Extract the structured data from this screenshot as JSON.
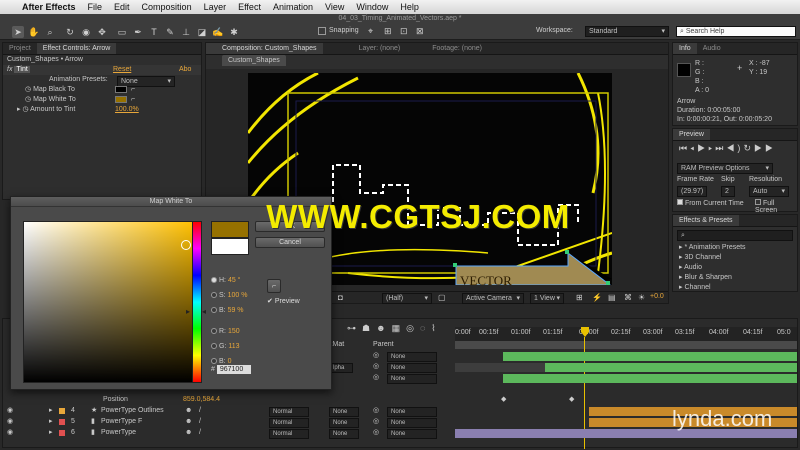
{
  "menubar": {
    "app": "After Effects",
    "items": [
      "File",
      "Edit",
      "Composition",
      "Layer",
      "Effect",
      "Animation",
      "View",
      "Window",
      "Help"
    ]
  },
  "toolbar": {
    "file_title": "04_03_Timing_Animated_Vectors.aep *",
    "snapping_label": "Snapping",
    "workspace_label": "Workspace:",
    "workspace_value": "Standard",
    "search_placeholder": "Search Help"
  },
  "left_panel": {
    "tabs": [
      "Project",
      "Effect Controls: Arrow"
    ],
    "breadcrumb": "Custom_Shapes • Arrow",
    "effect_name": "Tint",
    "reset_label": "Reset",
    "about_label": "Abo",
    "animation_presets_label": "Animation Presets:",
    "animation_presets_value": "None",
    "props": [
      {
        "label": "Map Black To"
      },
      {
        "label": "Map White To"
      },
      {
        "label": "Amount to Tint",
        "value": "100.0%"
      }
    ]
  },
  "comp_panel": {
    "tabs": [
      "Composition: Custom_Shapes",
      "Layer: (none)",
      "Footage: (none)"
    ],
    "comp_tab": "Custom_Shapes",
    "vector_text": "VECTOR",
    "bottom_controls": [
      "(Half)",
      "Active Camera",
      "1 View"
    ],
    "exposure": "+0.0"
  },
  "watermark": "WWW.CGTSJ.COM",
  "color_picker": {
    "title": "Map White To",
    "ok_label": "OK",
    "cancel_label": "Cancel",
    "preview_label": "Preview",
    "fields": [
      {
        "key": "H:",
        "value": "45 °"
      },
      {
        "key": "S:",
        "value": "100 %"
      },
      {
        "key": "B:",
        "value": "59 %"
      },
      {
        "key": "R:",
        "value": "150"
      },
      {
        "key": "G:",
        "value": "113"
      },
      {
        "key": "B:",
        "value": "0"
      }
    ],
    "hex_key": "#",
    "hex_value": "967100"
  },
  "info_panel": {
    "tabs": [
      "Info",
      "Audio"
    ],
    "r": "R :",
    "g": "G :",
    "b": "B :",
    "a": "A : 0",
    "x": "X : -87",
    "y": "Y : 19",
    "layer_name": "Arrow",
    "duration": "Duration: 0:00:05:00",
    "in_out": "In: 0:00:00:21, Out: 0:00:05:20"
  },
  "preview_panel": {
    "tab": "Preview",
    "ram_preview": "RAM Preview Options",
    "frame_rate_label": "Frame Rate",
    "skip_label": "Skip",
    "resolution_label": "Resolution",
    "frame_rate_value": "(29.97)",
    "skip_value": "2",
    "resolution_value": "Auto",
    "from_current_time": "From Current Time",
    "full_screen": "Full Screen"
  },
  "effects_panel": {
    "tab": "Effects & Presets",
    "items": [
      "* Animation Presets",
      "3D Channel",
      "Audio",
      "Blur & Sharpen",
      "Channel"
    ]
  },
  "timeline": {
    "ruler": [
      "0:00f",
      "00:15f",
      "01:00f",
      "01:15f",
      "02:00f",
      "02:15f",
      "03:00f",
      "03:15f",
      "04:00f",
      "04:15f",
      "05:0"
    ],
    "col_trkmat": "kMat",
    "col_parent": "Parent",
    "upper_rows": [
      {
        "trkmat": "",
        "parent": "None"
      },
      {
        "trkmat": "lpha",
        "parent": "None"
      },
      {
        "trkmat": "",
        "parent": "None"
      }
    ],
    "position_label": "Position",
    "position_value": "859.0,584.4",
    "layers": [
      {
        "num": "4",
        "name": "PowerType Outlines",
        "mode": "Normal",
        "trkmat": "None",
        "parent": "None",
        "label_color": "#e8a73a"
      },
      {
        "num": "5",
        "name": "PowerType F",
        "mode": "Normal",
        "trkmat": "None",
        "parent": "None",
        "label_color": "#e05050"
      },
      {
        "num": "6",
        "name": "PowerType",
        "mode": "Normal",
        "trkmat": "None",
        "parent": "None",
        "label_color": "#e05050"
      }
    ]
  },
  "brand": "lynda.com"
}
